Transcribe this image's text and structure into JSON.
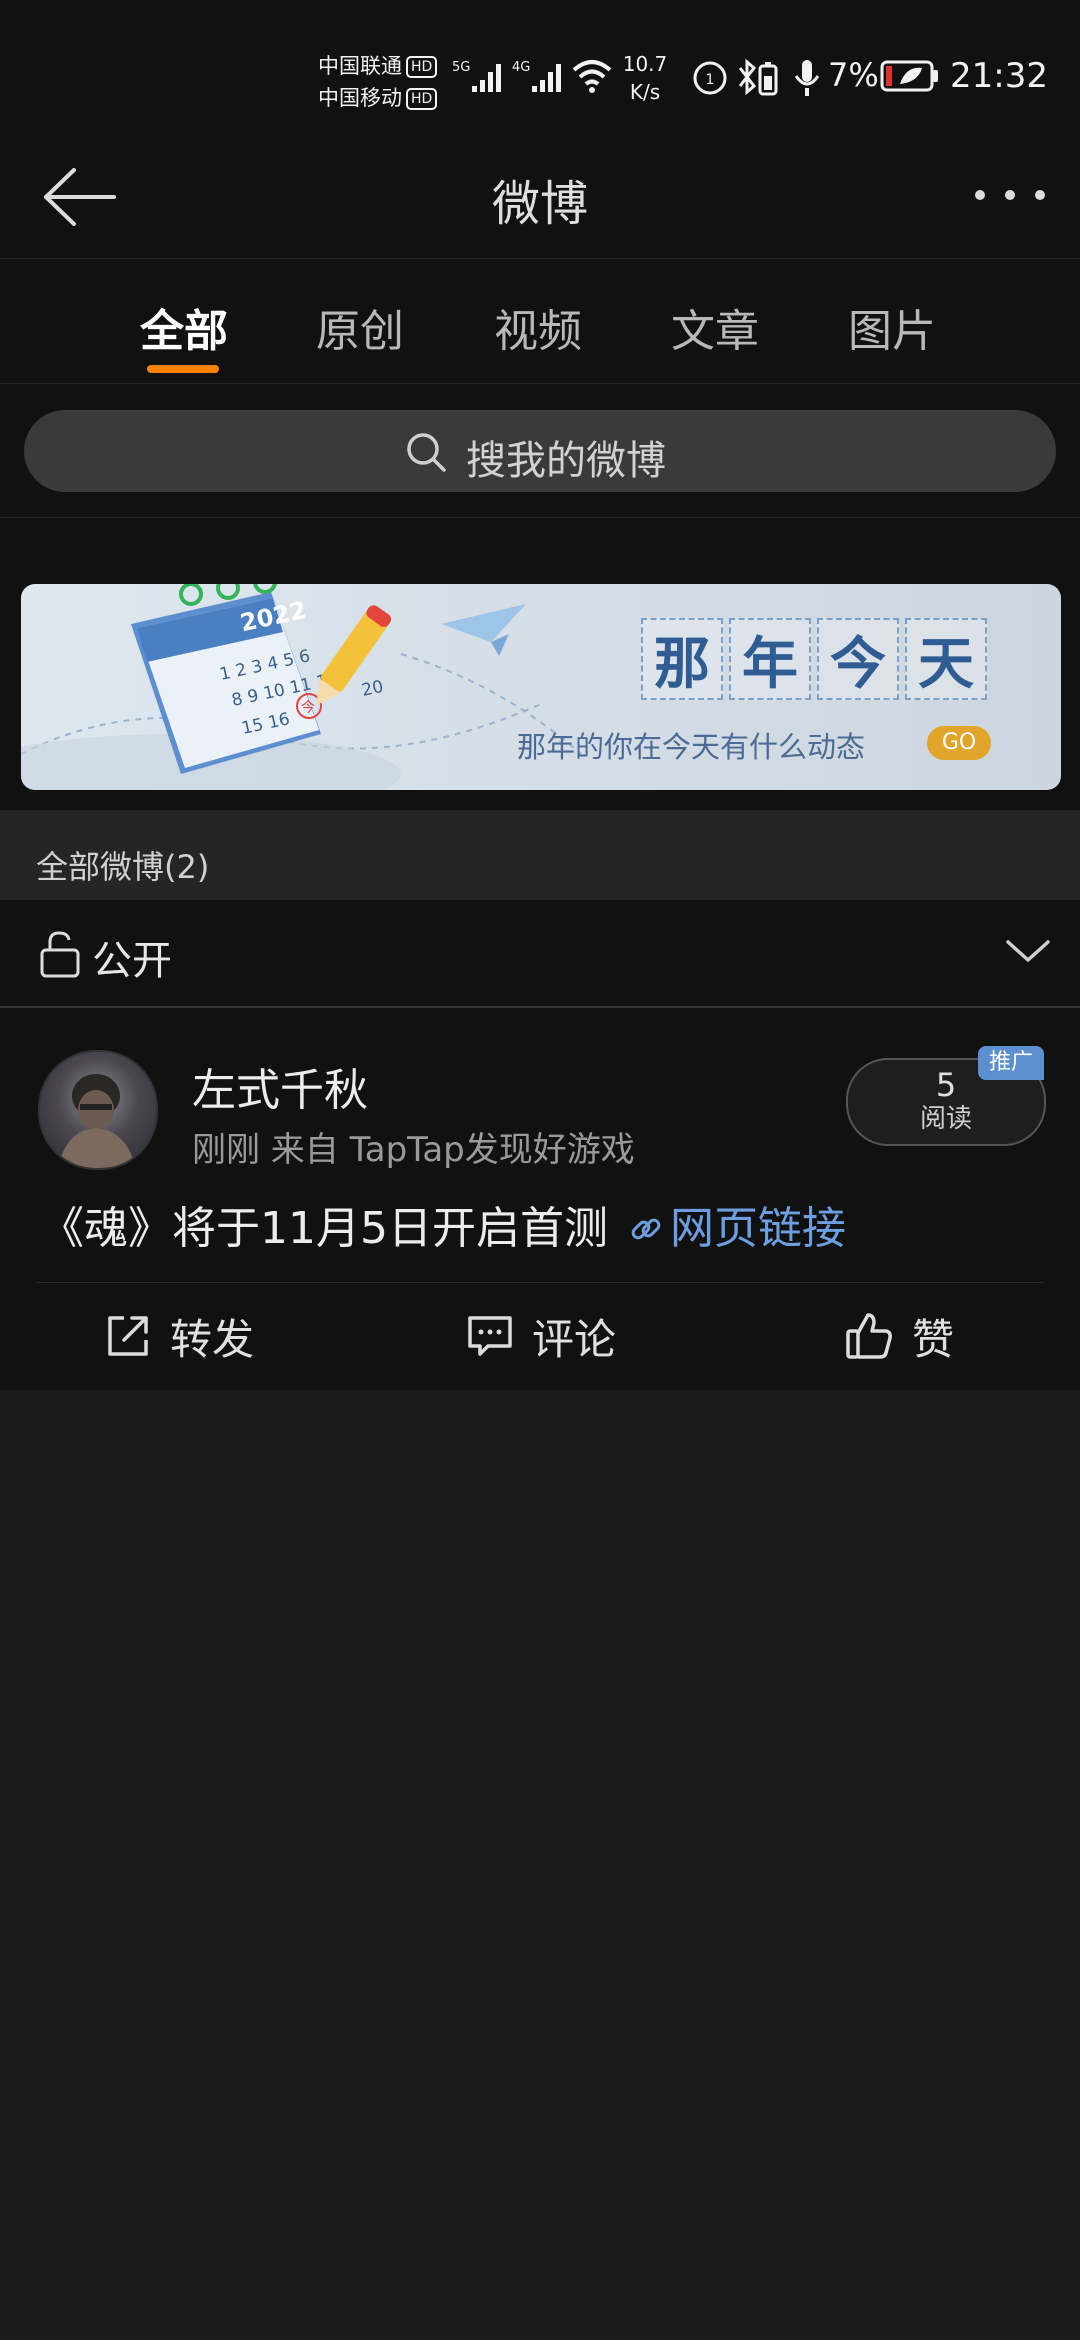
{
  "status_bar": {
    "carrier_1": "中国联通",
    "carrier_2": "中国移动",
    "hd_badge": "HD",
    "net_1": "5G",
    "net_2": "4G",
    "speed_value": "10.7",
    "speed_unit": "K/s",
    "battery": "7%",
    "time": "21:32"
  },
  "header": {
    "title": "微博"
  },
  "tabs": [
    {
      "label": "全部",
      "active": true
    },
    {
      "label": "原创",
      "active": false
    },
    {
      "label": "视频",
      "active": false
    },
    {
      "label": "文章",
      "active": false
    },
    {
      "label": "图片",
      "active": false
    }
  ],
  "search": {
    "placeholder": "搜我的微博"
  },
  "banner": {
    "title_chars": [
      "那",
      "年",
      "今",
      "天"
    ],
    "subtitle": "那年的你在今天有什么动态",
    "go_label": "GO",
    "calendar_year": "2022",
    "calendar_nums_1": "1 2 3 4 5 6",
    "calendar_nums_2": "8 9 10 11 12",
    "calendar_nums_3": "15 16",
    "calendar_today": "今",
    "calendar_num_20": "20"
  },
  "section": {
    "label": "全部微博(2)"
  },
  "filter": {
    "label": "公开"
  },
  "post": {
    "username": "左式千秋",
    "meta": "刚刚   来自 TapTap发现好游戏",
    "reads_count": "5",
    "reads_label": "阅读",
    "promo_badge": "推广",
    "text": "《魂》将于11月5日开启首测",
    "link_label": "网页链接",
    "actions": {
      "repost": "转发",
      "comment": "评论",
      "like": "赞"
    }
  },
  "colors": {
    "accent_tab": "#ff8200",
    "link": "#6d9fe0",
    "promo": "#5b8fd0",
    "go": "#e0a52a"
  }
}
